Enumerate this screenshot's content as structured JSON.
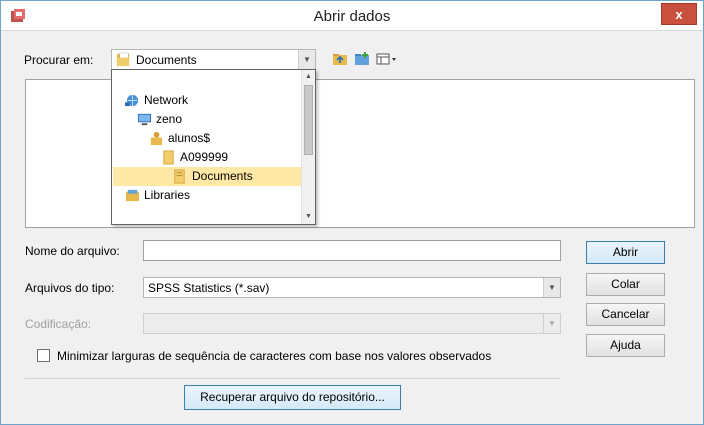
{
  "window": {
    "title": "Abrir dados",
    "close_label": "x"
  },
  "look_in": {
    "label": "Procurar em:",
    "value": "Documents"
  },
  "toolbar": {
    "icons": [
      "up-folder-icon",
      "new-folder-icon",
      "view-menu-icon"
    ]
  },
  "dropdown": {
    "items": [
      {
        "label": "Network",
        "icon": "network-icon"
      },
      {
        "label": "zeno",
        "icon": "computer-icon"
      },
      {
        "label": "alunos$",
        "icon": "user-folder-icon"
      },
      {
        "label": "A099999",
        "icon": "folder-icon"
      },
      {
        "label": "Documents",
        "icon": "documents-folder-icon",
        "selected": true
      },
      {
        "label": "Libraries",
        "icon": "libraries-icon"
      }
    ]
  },
  "filename": {
    "label": "Nome do arquivo:",
    "value": ""
  },
  "filetype": {
    "label": "Arquivos do tipo:",
    "value": "SPSS Statistics (*.sav)"
  },
  "encoding": {
    "label": "Codificação:",
    "value": ""
  },
  "checkbox": {
    "label": "Minimizar larguras de sequência de caracteres com base nos valores observados",
    "checked": false
  },
  "buttons": {
    "open": "Abrir",
    "paste": "Colar",
    "cancel": "Cancelar",
    "help": "Ajuda",
    "retrieve": "Recuperar arquivo do repositório..."
  },
  "colors": {
    "selected_bg": "#ffe8a6",
    "close_bg": "#c9503f",
    "folder": "#e8b84a"
  }
}
